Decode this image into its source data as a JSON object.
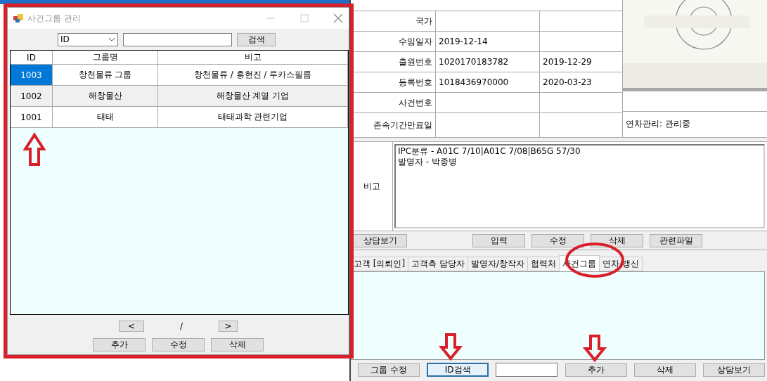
{
  "dialog": {
    "title": "사건그룹 관리",
    "search": {
      "field": "ID",
      "button": "검색"
    },
    "grid": {
      "columns": [
        "ID",
        "그룹명",
        "비고"
      ],
      "rows": [
        {
          "cells": [
            "1003",
            "창천물류 그룹",
            "창천물류 / 홍현진 / 루카스필름"
          ],
          "selected": true
        },
        {
          "cells": [
            "1002",
            "해창물산",
            "해창물산 계열 기업"
          ],
          "selected": false
        },
        {
          "cells": [
            "1001",
            "태태",
            "태태과학 관련기업"
          ],
          "selected": false
        }
      ]
    },
    "pager": {
      "prev": "<",
      "separator": "/",
      "next": ">"
    },
    "buttons": [
      "추가",
      "수정",
      "삭제"
    ]
  },
  "details": {
    "rows": [
      {
        "label": "국가"
      },
      {
        "label": "수임일자",
        "value_1": "2019-12-14"
      },
      {
        "label": "출원번호",
        "value_1": "1020170183782",
        "value_2": "2019-12-29"
      },
      {
        "label": "등록번호",
        "value_1": "1018436970000",
        "value_2": "2020-03-23"
      },
      {
        "label": "사건번호"
      },
      {
        "label": "존속기간만료일",
        "side": "연차관리: 관리중"
      }
    ],
    "remarks": {
      "label": "비고",
      "lines": [
        "IPC분류 - A01C 7/10|A01C 7/08|B65G 57/30",
        "발명자 - 박종병"
      ]
    },
    "left_button": "상담보기",
    "buttons": [
      "입력",
      "수정",
      "삭제",
      "관련파일"
    ]
  },
  "tabs": [
    {
      "label": "고객 [의뢰인]",
      "selected": false
    },
    {
      "label": "고객측 담당자",
      "selected": false
    },
    {
      "label": "발명자/창작자",
      "selected": false
    },
    {
      "label": "협력처",
      "selected": false
    },
    {
      "label": "사건그룹",
      "selected": true
    },
    {
      "label": "연차/갱신",
      "selected": false
    }
  ],
  "bottom_bar": [
    {
      "kind": "button",
      "label": "그룹 수정",
      "focused": false
    },
    {
      "kind": "button",
      "label": "ID검색",
      "focused": true
    },
    {
      "kind": "field"
    },
    {
      "kind": "button",
      "label": "추가",
      "focused": false
    },
    {
      "kind": "button",
      "label": "삭제",
      "focused": false
    },
    {
      "kind": "button",
      "label": "상담보기",
      "focused": false
    }
  ]
}
